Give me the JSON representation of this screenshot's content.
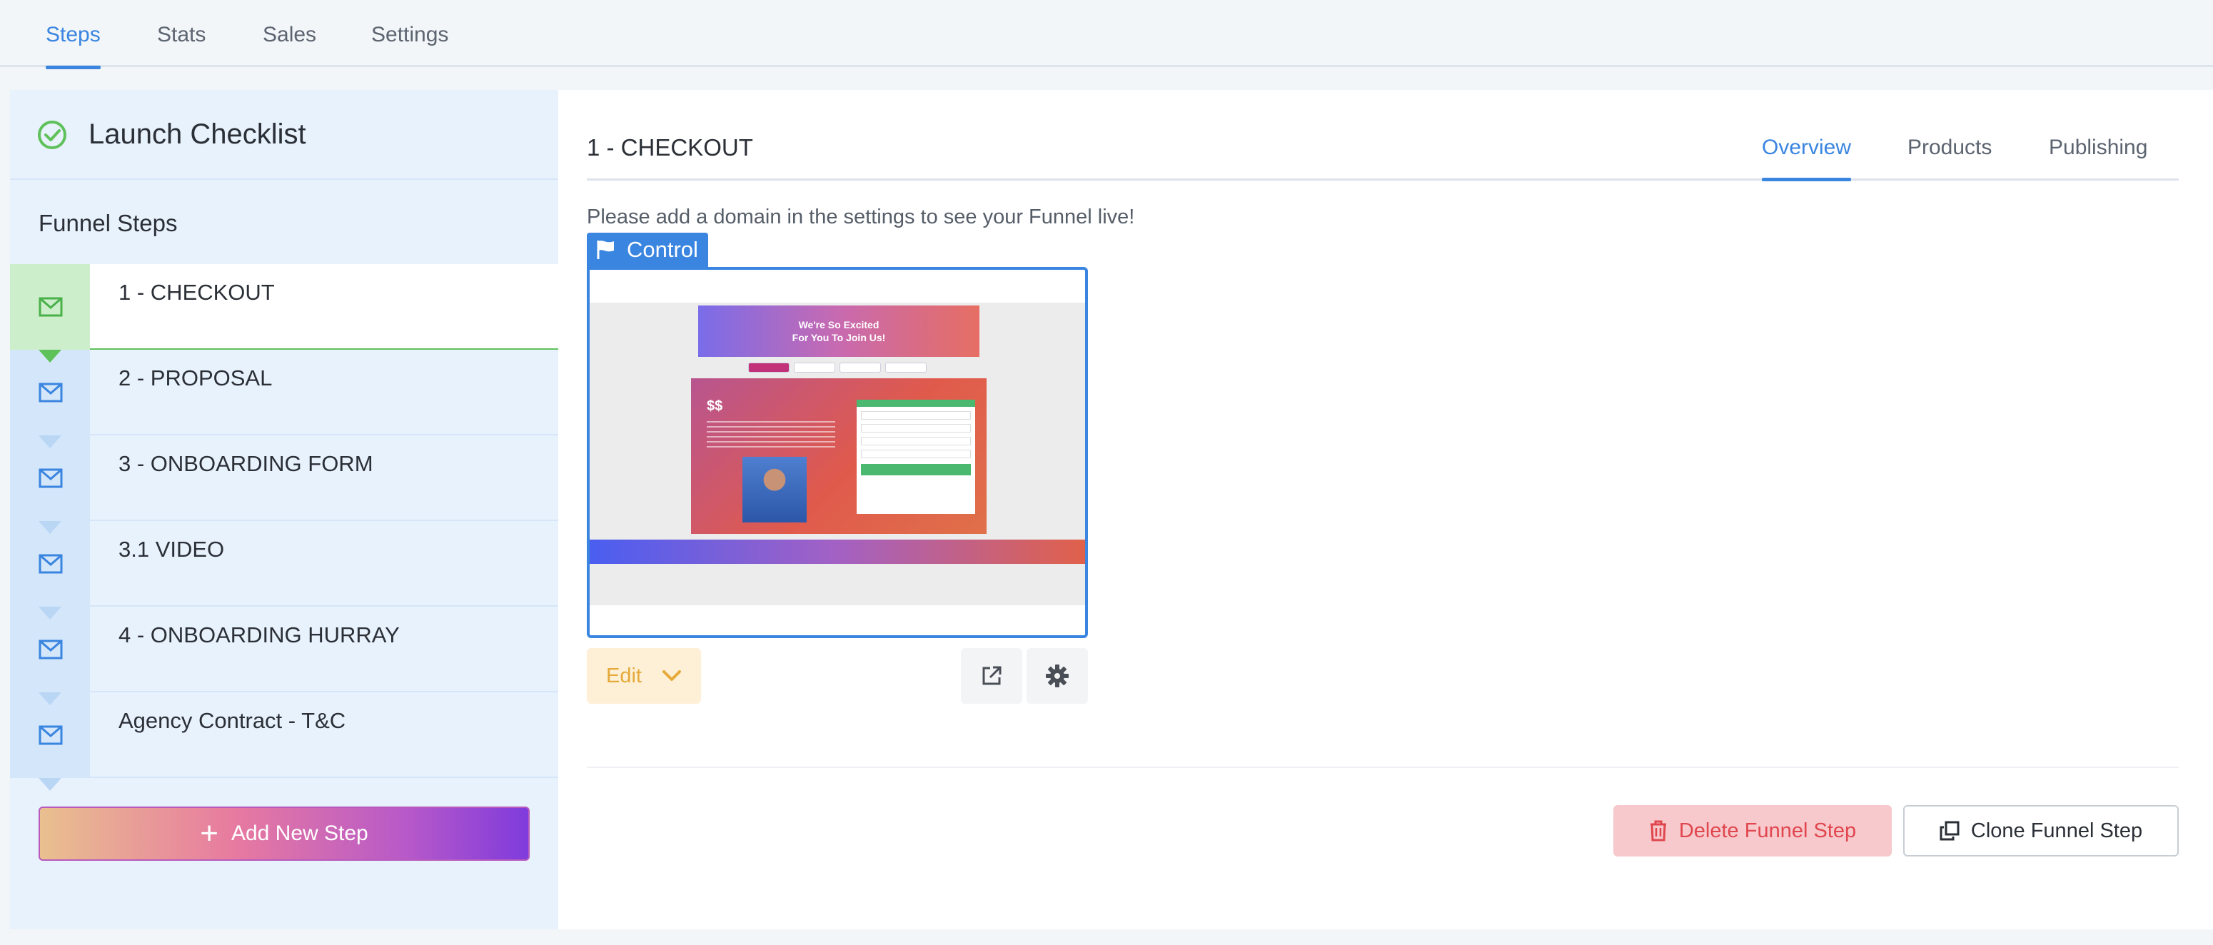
{
  "topnav": {
    "tabs": [
      {
        "label": "Steps",
        "active": true
      },
      {
        "label": "Stats",
        "active": false
      },
      {
        "label": "Sales",
        "active": false
      },
      {
        "label": "Settings",
        "active": false
      }
    ]
  },
  "sidebar": {
    "checklist_title": "Launch Checklist",
    "funnel_heading": "Funnel Steps",
    "steps": [
      {
        "label": "1 - CHECKOUT",
        "active": true
      },
      {
        "label": "2 - PROPOSAL",
        "active": false
      },
      {
        "label": "3 - ONBOARDING FORM",
        "active": false
      },
      {
        "label": "3.1 VIDEO",
        "active": false
      },
      {
        "label": "4 - ONBOARDING HURRAY",
        "active": false
      },
      {
        "label": "Agency Contract - T&C",
        "active": false
      }
    ],
    "add_step_label": "Add New Step"
  },
  "main": {
    "step_title": "1 - CHECKOUT",
    "tabs": [
      {
        "label": "Overview",
        "active": true
      },
      {
        "label": "Products",
        "active": false
      },
      {
        "label": "Publishing",
        "active": false
      }
    ],
    "domain_note": "Please add a domain in the settings to see your Funnel live!",
    "control_label": "Control",
    "preview": {
      "hero_line1": "We're So Excited",
      "hero_line2": "For You To Join Us!",
      "price": "$$"
    },
    "edit_label": "Edit",
    "delete_label": "Delete Funnel Step",
    "clone_label": "Clone Funnel Step"
  },
  "colors": {
    "accent": "#3a85e0",
    "success": "#5fc15a",
    "danger": "#e0464e",
    "warning": "#e6a93a"
  },
  "icons": {
    "check": "check-circle-icon",
    "step": "envelope-icon",
    "flag": "flag-icon",
    "chevron": "chevron-down-icon",
    "external": "external-link-icon",
    "gear": "gear-icon",
    "trash": "trash-icon",
    "clone": "clone-icon",
    "plus": "plus-icon"
  }
}
